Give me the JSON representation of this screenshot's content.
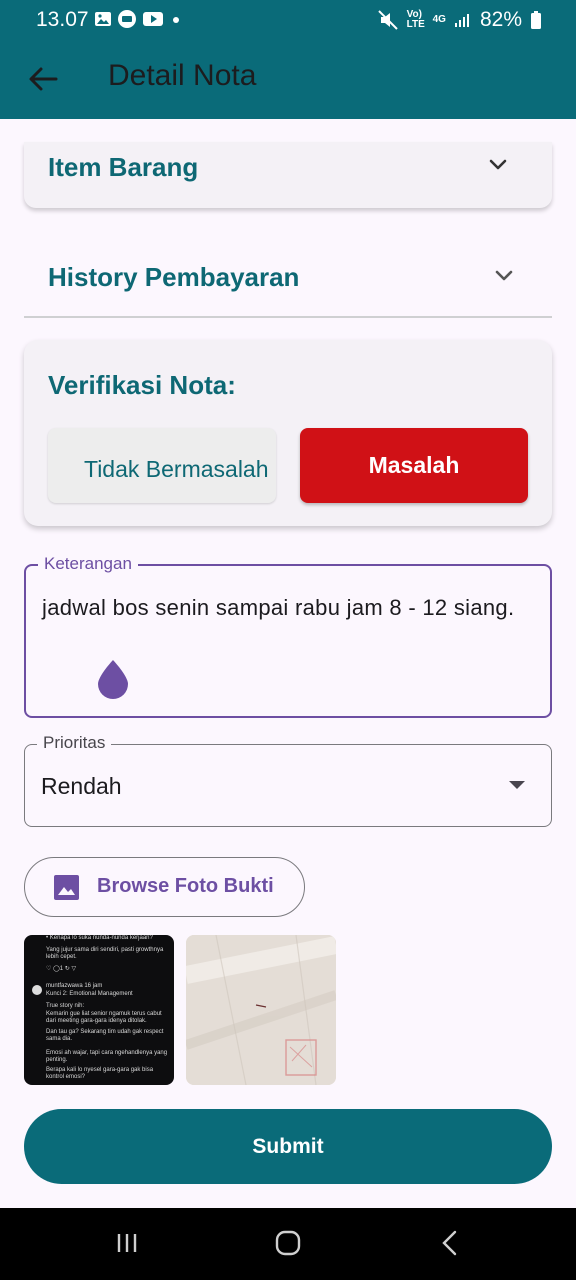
{
  "status_bar": {
    "time": "13.07",
    "battery": "82%",
    "network": "4G",
    "volte": "Vo) LTE",
    "icons": [
      "image-icon",
      "message-icon",
      "youtube-icon",
      "dot-icon",
      "mute-icon",
      "signal-icon",
      "battery-icon"
    ]
  },
  "app_bar": {
    "title": "Detail Nota",
    "back_icon": "arrow-left-icon"
  },
  "sections": {
    "item_barang": "Item Barang",
    "history_pembayaran": "History Pembayaran"
  },
  "verifikasi": {
    "title": "Verifikasi Nota:",
    "ok_label": "Tidak Bermasalah",
    "problem_label": "Masalah"
  },
  "keterangan": {
    "label": "Keterangan",
    "value": "jadwal bos senin sampai rabu jam 8 - 12 siang."
  },
  "prioritas": {
    "label": "Prioritas",
    "selected": "Rendah"
  },
  "browse": {
    "label": "Browse Foto Bukti",
    "icon": "image-icon"
  },
  "photos": {
    "p1_lines": [
      "• Kenapa lo suka nunda-nunda kerjaan?",
      "Yang jujur sama diri sendiri, pasti growthnya lebih cepet.",
      "♡   ◯1   ↻   ▽",
      "muntfazwawa  16 jam",
      "Kunci 2: Emotional Management",
      "True story nih:",
      "Kemarin gue liat senior ngamuk terus cabut dari meeting gara-gara idenya ditolak.",
      "Dan tau ga? Sekarang tim udah gak respect sama dia.",
      "Emosi ah wajar, tapi cara ngehandlenya yang penting.",
      "Berapa kali lo nyesel gara-gara gak bisa kontrol emosi?"
    ]
  },
  "submit_label": "Submit",
  "colors": {
    "primary": "#0a6b79",
    "accent": "#6d4fa3",
    "danger": "#d01116",
    "background": "#fcf7fe"
  }
}
